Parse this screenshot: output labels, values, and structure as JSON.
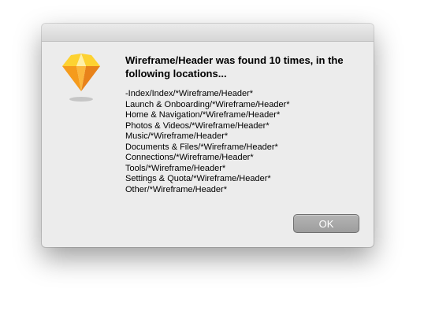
{
  "dialog": {
    "app_icon": "sketch-diamond-icon",
    "headline": "Wireframe/Header was found 10 times, in the following locations...",
    "locations": [
      "-Index/Index/*Wireframe/Header*",
      "Launch & Onboarding/*Wireframe/Header*",
      "Home & Navigation/*Wireframe/Header*",
      "Photos & Videos/*Wireframe/Header*",
      "Music/*Wireframe/Header*",
      "Documents & Files/*Wireframe/Header*",
      "Connections/*Wireframe/Header*",
      "Tools/*Wireframe/Header*",
      "Settings & Quota/*Wireframe/Header*",
      "Other/*Wireframe/Header*"
    ],
    "ok_label": "OK"
  },
  "colors": {
    "dialog_background": "#ececec",
    "button_gray": "#a9a9a9",
    "icon_orange": "#f5a623",
    "icon_yellow": "#fdd231"
  }
}
